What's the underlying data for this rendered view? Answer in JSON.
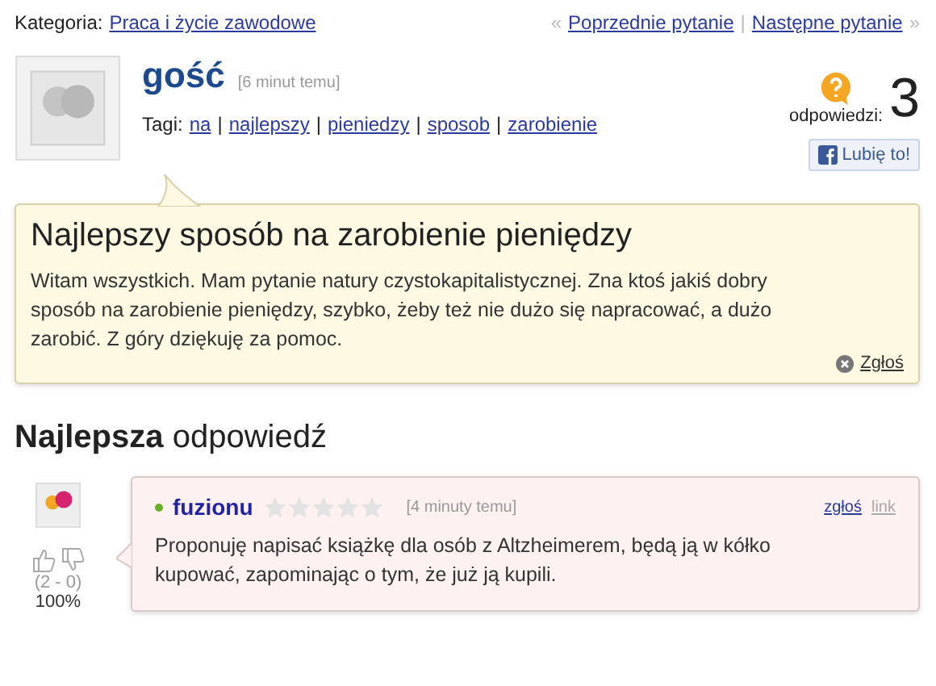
{
  "category": {
    "label": "Kategoria:",
    "value": "Praca i życie zawodowe"
  },
  "nav": {
    "prev_mark": "«",
    "prev": "Poprzednie pytanie",
    "separator": "|",
    "next": "Następne pytanie",
    "next_mark": "»"
  },
  "question": {
    "author": "gość",
    "time": "[6 minut temu]",
    "tags_label": "Tagi:",
    "tag_separator": "|",
    "tags": [
      "na",
      "najlepszy",
      "pieniedzy",
      "sposob",
      "zarobienie"
    ],
    "answers_label": "odpowiedzi:",
    "answers_count": "3",
    "like": "Lubię to!",
    "title": "Najlepszy sposób na zarobienie pieniędzy",
    "body": "Witam wszystkich. Mam pytanie natury czystokapitalistycznej. Zna ktoś jakiś dobry sposób na zarobienie pieniędzy, szybko, żeby też nie dużo się napracować, a dużo zarobić. Z góry dziękuję za pomoc.",
    "report": "Zgłoś"
  },
  "best_answer": {
    "heading": "**Najlepsza** odpowiedź",
    "author": "fuzionu",
    "online": true,
    "stars": 0,
    "time": "[4 minuty temu]",
    "report": "zgłoś",
    "link": "link",
    "body": "Proponuję napisać książkę dla osób z Altzheimerem, będą ją w kółko kupować, zapominając o tym, że już ją kupili.",
    "votes": "(2 - 0)",
    "percent": "100%"
  }
}
